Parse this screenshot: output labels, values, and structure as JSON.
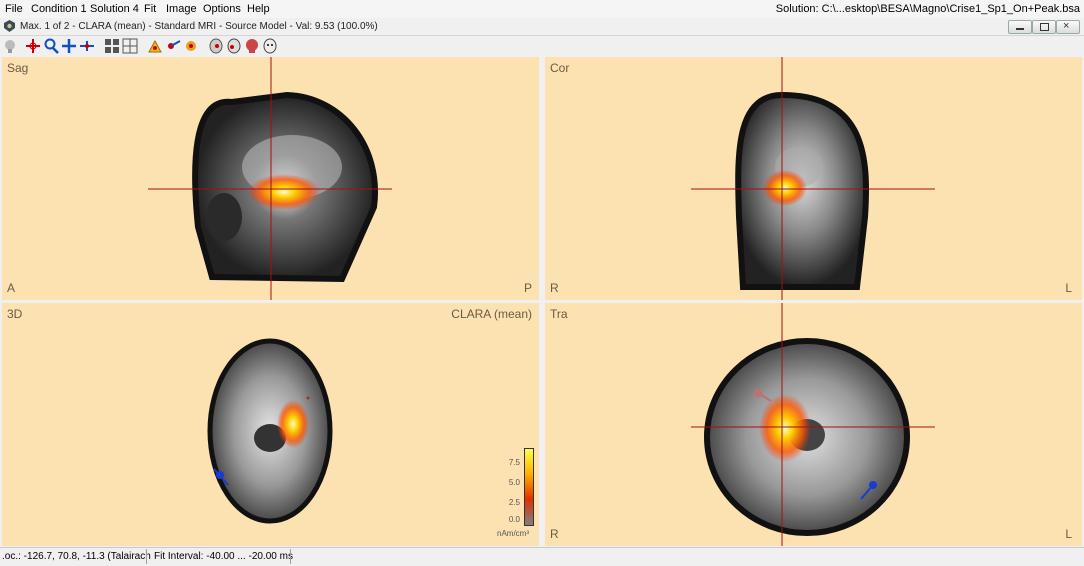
{
  "menu": {
    "items": [
      "File",
      "Condition 1",
      "Solution 4",
      "Fit",
      "Image",
      "Options",
      "Help"
    ],
    "solution": "Solution: C:\\...esktop\\BESA\\Magno\\Crise1_Sp1_On+Peak.bsa"
  },
  "window": {
    "title": "Max. 1 of 2 - CLARA (mean) - Standard MRI - Source Model - Val: 9.53 (100.0%)"
  },
  "panels": {
    "sag": {
      "label": "Sag",
      "left": "A",
      "right": "P"
    },
    "cor": {
      "label": "Cor",
      "left": "R",
      "right": "L"
    },
    "three_d": {
      "label": "3D",
      "method": "CLARA (mean)"
    },
    "tra": {
      "label": "Tra",
      "left": "R",
      "right": "L"
    }
  },
  "colorbar": {
    "ticks": [
      "7.5",
      "5.0",
      "2.5",
      "0.0"
    ],
    "unit": "nAm/cm³",
    "colors": [
      "#ffff40",
      "#ffb000",
      "#e03000",
      "#808080"
    ]
  },
  "status": {
    "loc": ".oc.: -126.7, 70.8, -11.3  (Talairach",
    "fit": "Fit Interval: -40.00 ... -20.00 ms"
  },
  "icons": [
    "zoom-icon",
    "cursor-icon",
    "magnify-icon",
    "move-icon",
    "pan-icon",
    "grid-icon",
    "layout-icon",
    "fit-icon",
    "dipole-icon",
    "source-icon",
    "mri-icon",
    "head-icon",
    "skull-icon",
    "face-icon"
  ]
}
